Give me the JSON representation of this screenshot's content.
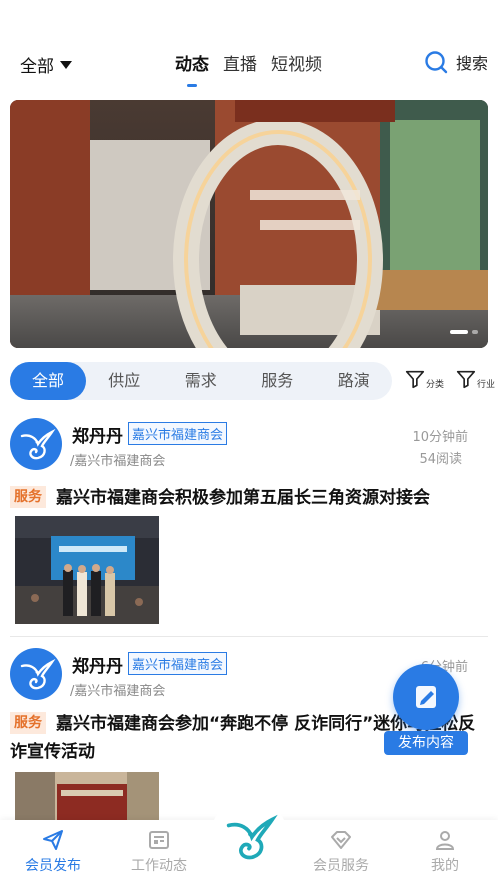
{
  "header": {
    "filter_label": "全部",
    "tabs": [
      "动态",
      "直播",
      "短视频"
    ],
    "search_label": "搜索"
  },
  "banner": {
    "dots": 2,
    "active_dot": 0
  },
  "categories": [
    "全部",
    "供应",
    "需求",
    "服务",
    "路演"
  ],
  "filters": {
    "category": "分类",
    "industry": "行业"
  },
  "posts": [
    {
      "author": "郑丹丹",
      "org_tag": "嘉兴市福建商会",
      "org_sub": "/嘉兴市福建商会",
      "time": "10分钟前",
      "reads": "54阅读",
      "badge": "服务",
      "title": "嘉兴市福建商会积极参加第五届长三角资源对接会"
    },
    {
      "author": "郑丹丹",
      "org_tag": "嘉兴市福建商会",
      "org_sub": "/嘉兴市福建商会",
      "time": "6分钟前",
      "badge": "服务",
      "title": "嘉兴市福建商会参加“奔跑不停 反诈同行”迷你马拉松反诈宣传活动"
    }
  ],
  "fab": {
    "label": "发布内容"
  },
  "bottom_nav": [
    "会员发布",
    "工作动态",
    "会员服务",
    "我的"
  ],
  "colors": {
    "accent": "#2a7be4",
    "badge_bg": "#fde9dc",
    "badge_text": "#e4712b"
  }
}
